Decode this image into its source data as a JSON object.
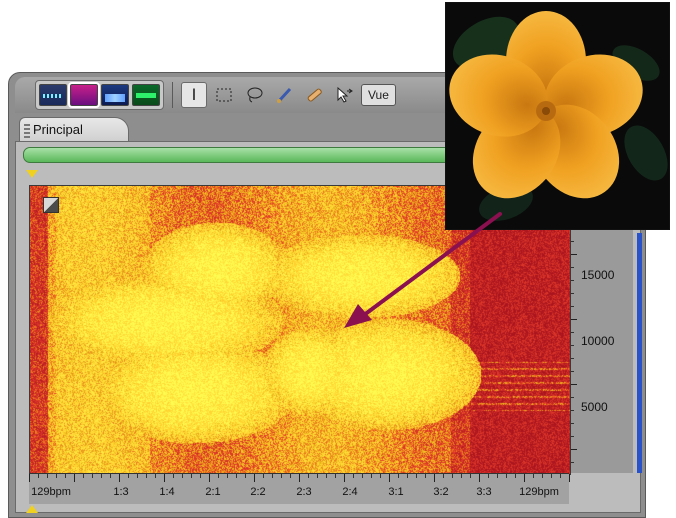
{
  "toolbar": {
    "view_buttons": [
      "waveform-view",
      "spectral-frequency-view",
      "spectral-pan-view",
      "spectral-phase-view"
    ],
    "tools": [
      "time-selection-icon",
      "marquee-selection-icon",
      "lasso-selection-icon",
      "brush-selection-icon",
      "spot-healing-icon",
      "move-pointer-icon"
    ],
    "view_select_label": "Vue"
  },
  "tab": {
    "label": "Principal"
  },
  "spectrogram": {
    "y_labels": [
      "15000",
      "10000",
      "5000"
    ],
    "x_labels": [
      "129bpm",
      "1:3",
      "1:4",
      "2:1",
      "2:2",
      "2:3",
      "2:4",
      "3:1",
      "3:2",
      "3:3",
      "129bpm"
    ]
  },
  "colors": {
    "hot": "#ffe040",
    "warm": "#f09020",
    "cold": "#c01828",
    "arrow": "#8a1050",
    "petal": "#f0a020"
  }
}
